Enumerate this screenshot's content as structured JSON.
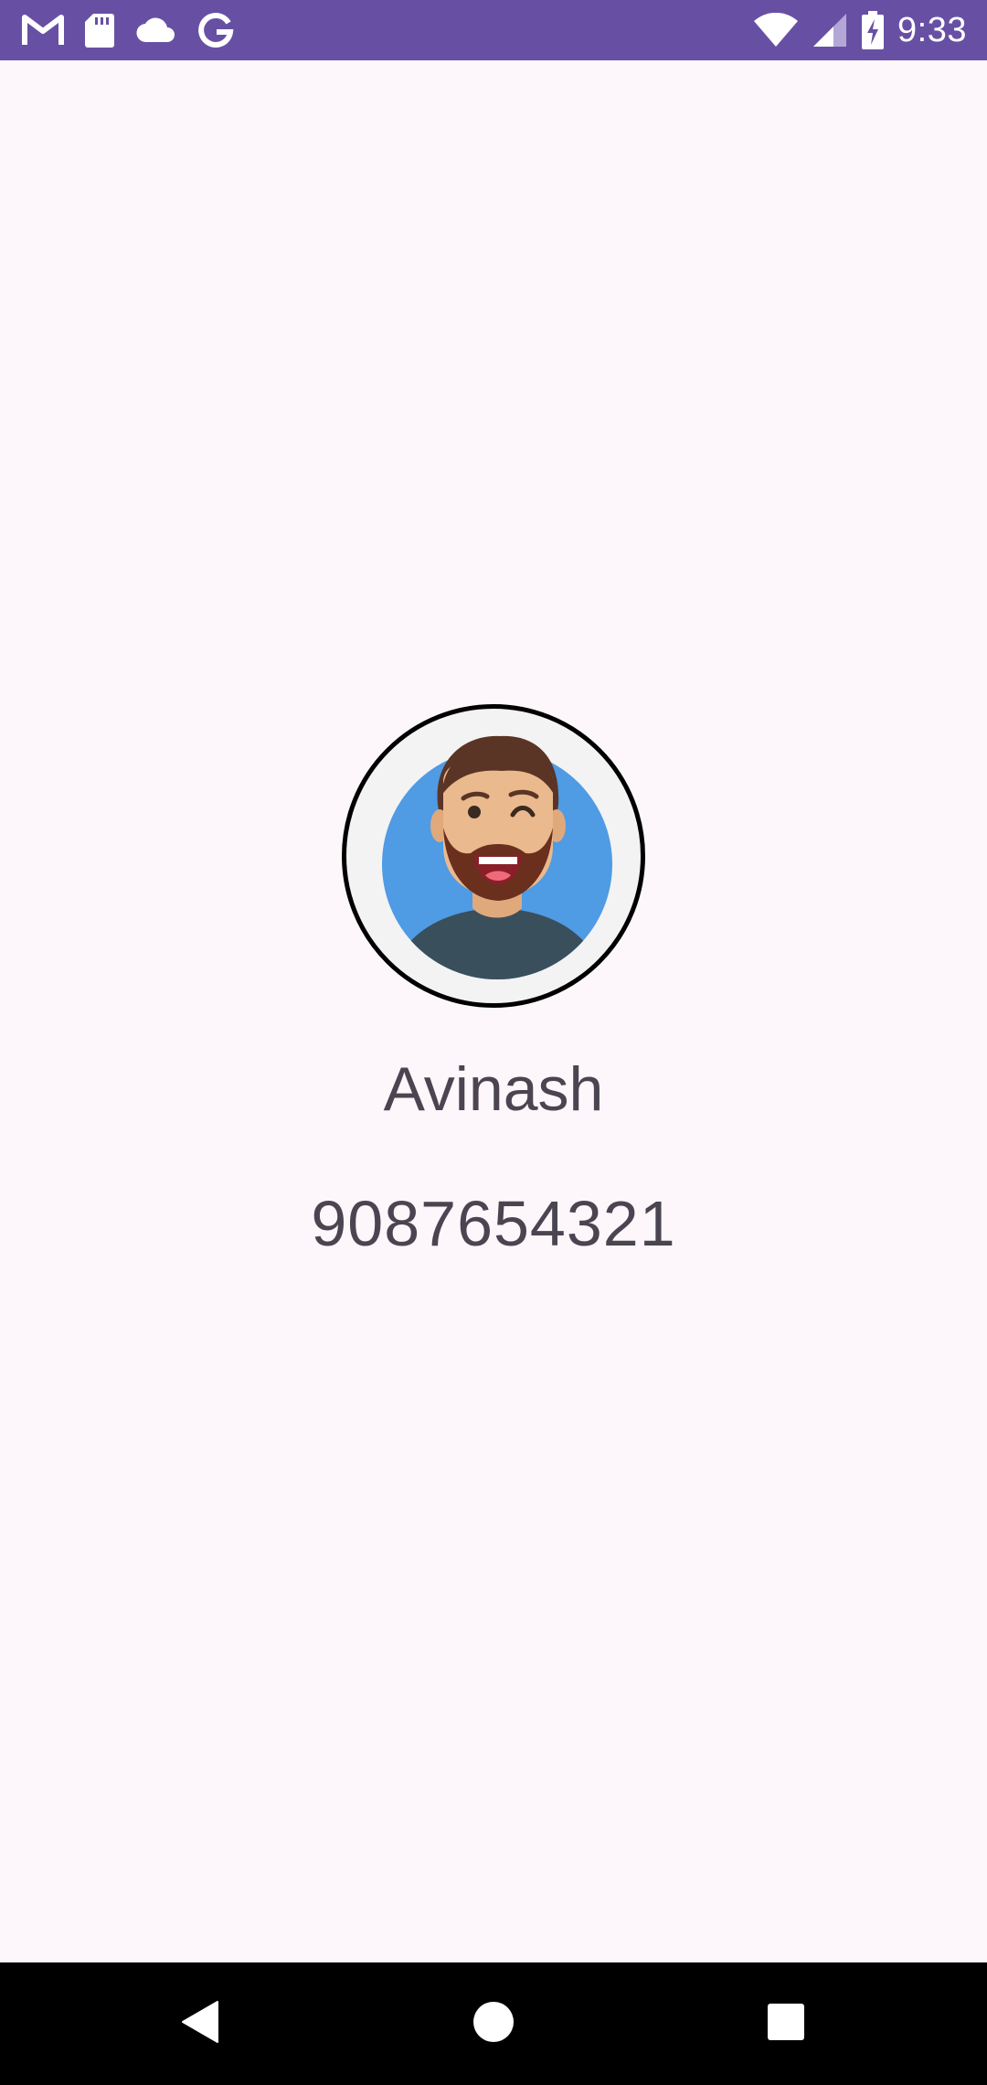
{
  "status_bar": {
    "time": "9:33",
    "background_color": "#6750a4",
    "left_icons": [
      "gmail-icon",
      "sd-card-icon",
      "cloud-icon",
      "google-icon"
    ],
    "right_icons": [
      "wifi-icon",
      "signal-icon",
      "battery-charging-icon"
    ]
  },
  "contact": {
    "name": "Avinash",
    "phone": "9087654321",
    "avatar": "man-winking-avatar"
  },
  "nav_bar": {
    "buttons": [
      "back-icon",
      "home-icon",
      "recents-icon"
    ]
  }
}
